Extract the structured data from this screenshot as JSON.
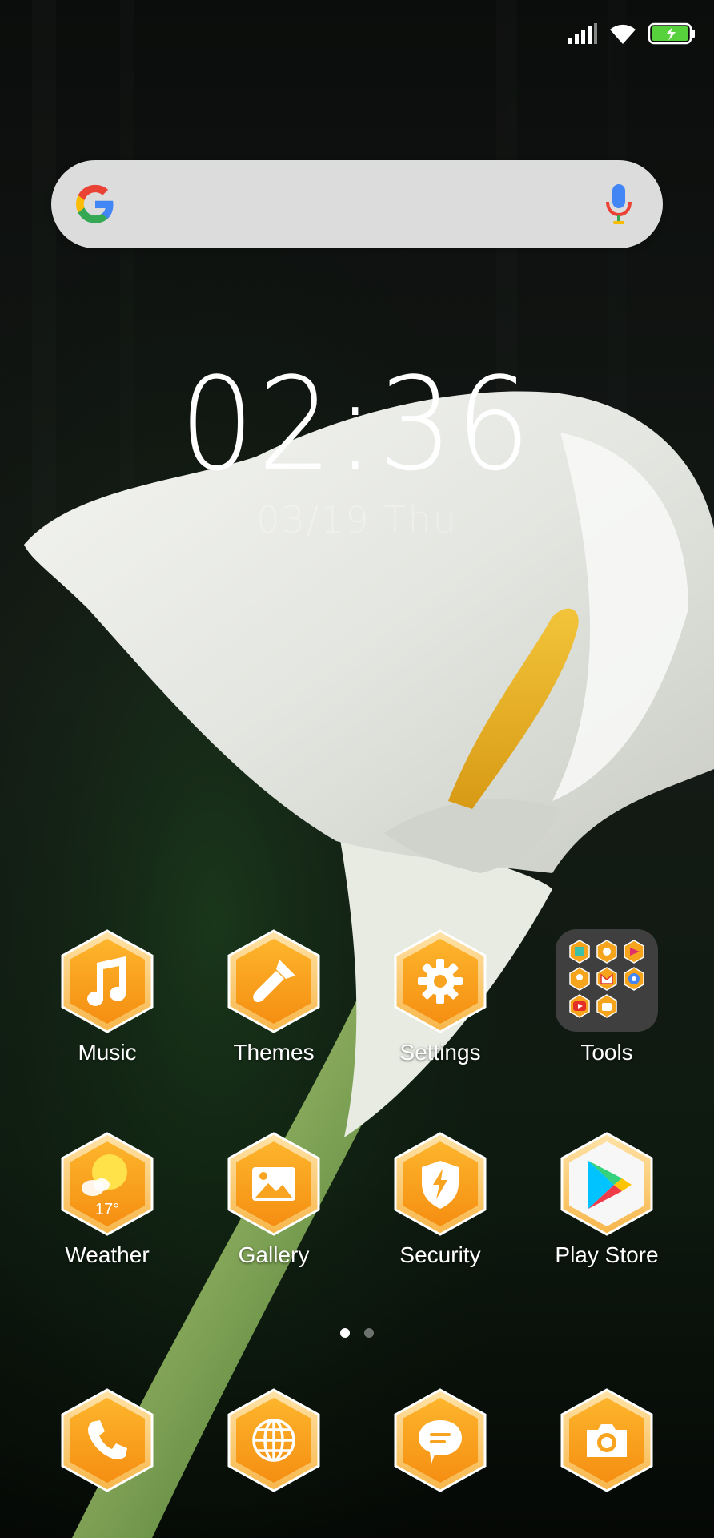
{
  "status_bar": {
    "signal_icon": "signal-icon",
    "wifi_icon": "wifi-icon",
    "battery_icon": "battery-charging-icon"
  },
  "search": {
    "logo": "google-icon",
    "mic": "mic-icon"
  },
  "clock": {
    "time": "02:36",
    "date": "03/19 Thu"
  },
  "apps_row1": [
    {
      "label": "Music",
      "icon": "music-note-icon"
    },
    {
      "label": "Themes",
      "icon": "paintbrush-icon"
    },
    {
      "label": "Settings",
      "icon": "gear-icon"
    },
    {
      "label": "Tools",
      "icon": "folder-icon"
    }
  ],
  "apps_row2": [
    {
      "label": "Weather",
      "icon": "weather-icon",
      "temp": "17°"
    },
    {
      "label": "Gallery",
      "icon": "image-icon"
    },
    {
      "label": "Security",
      "icon": "shield-bolt-icon"
    },
    {
      "label": "Play Store",
      "icon": "play-store-icon"
    }
  ],
  "dock": [
    {
      "icon": "phone-icon"
    },
    {
      "icon": "globe-icon"
    },
    {
      "icon": "message-icon"
    },
    {
      "icon": "camera-icon"
    }
  ],
  "pager": {
    "pages": 2,
    "active": 1
  },
  "colors": {
    "accent_orange": "#F6A41C",
    "hex_border": "#FFD27A",
    "search_bg": "#ECECEC"
  }
}
